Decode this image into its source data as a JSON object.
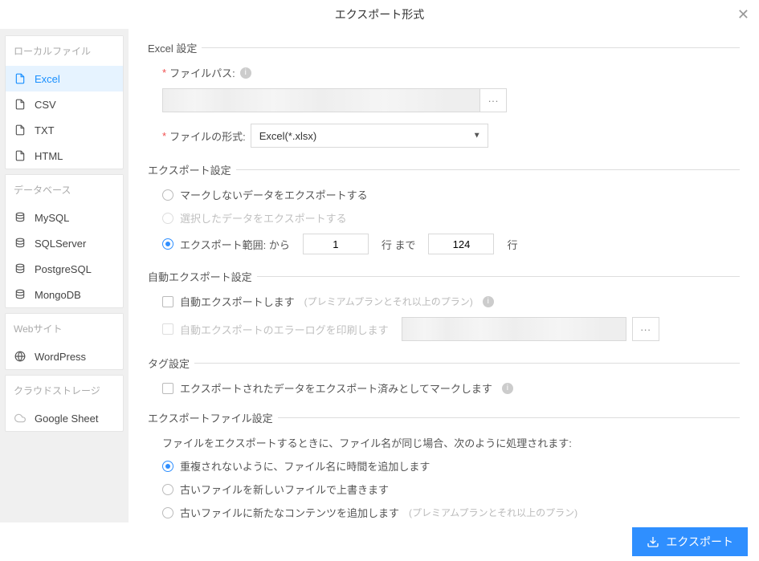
{
  "header": {
    "title": "エクスポート形式"
  },
  "sidebar": {
    "groups": [
      {
        "header": "ローカルファイル",
        "items": [
          {
            "label": "Excel",
            "icon": "file"
          },
          {
            "label": "CSV",
            "icon": "file"
          },
          {
            "label": "TXT",
            "icon": "file"
          },
          {
            "label": "HTML",
            "icon": "file"
          }
        ]
      },
      {
        "header": "データベース",
        "items": [
          {
            "label": "MySQL",
            "icon": "db"
          },
          {
            "label": "SQLServer",
            "icon": "db"
          },
          {
            "label": "PostgreSQL",
            "icon": "db"
          },
          {
            "label": "MongoDB",
            "icon": "db"
          }
        ]
      },
      {
        "header": "Webサイト",
        "items": [
          {
            "label": "WordPress",
            "icon": "web"
          }
        ]
      },
      {
        "header": "クラウドストレージ",
        "items": [
          {
            "label": "Google Sheet",
            "icon": "cloud"
          }
        ]
      }
    ]
  },
  "excel_settings": {
    "legend": "Excel 設定",
    "file_path_label": "ファイルパス:",
    "file_path_value": "",
    "file_format_label": "ファイルの形式:",
    "file_format_value": "Excel(*.xlsx)"
  },
  "export_settings": {
    "legend": "エクスポート設定",
    "opt_unmarked": "マークしないデータをエクスポートする",
    "opt_selected": "選択したデータをエクスポートする",
    "opt_range_prefix": "エクスポート範囲: から",
    "range_from": "1",
    "range_mid": "行  まで",
    "range_to": "124",
    "range_suffix": "行"
  },
  "auto_export": {
    "legend": "自動エクスポート設定",
    "opt_auto": "自動エクスポートします",
    "opt_auto_sub": "(プレミアムプランとそれ以上のプラン)",
    "opt_log": "自動エクスポートのエラーログを印刷します",
    "log_path": ""
  },
  "tag_settings": {
    "legend": "タグ設定",
    "opt_mark": "エクスポートされたデータをエクスポート済みとしてマークします"
  },
  "file_settings": {
    "legend": "エクスポートファイル設定",
    "hint": "ファイルをエクスポートするときに、ファイル名が同じ場合、次のように処理されます:",
    "opt_timestamp": "重複されないように、ファイル名に時間を追加します",
    "opt_overwrite": "古いファイルを新しいファイルで上書きます",
    "opt_append": "古いファイルに新たなコンテンツを追加します",
    "opt_append_sub": "(プレミアムプランとそれ以上のプラン)"
  },
  "footer": {
    "export_label": "エクスポート"
  }
}
